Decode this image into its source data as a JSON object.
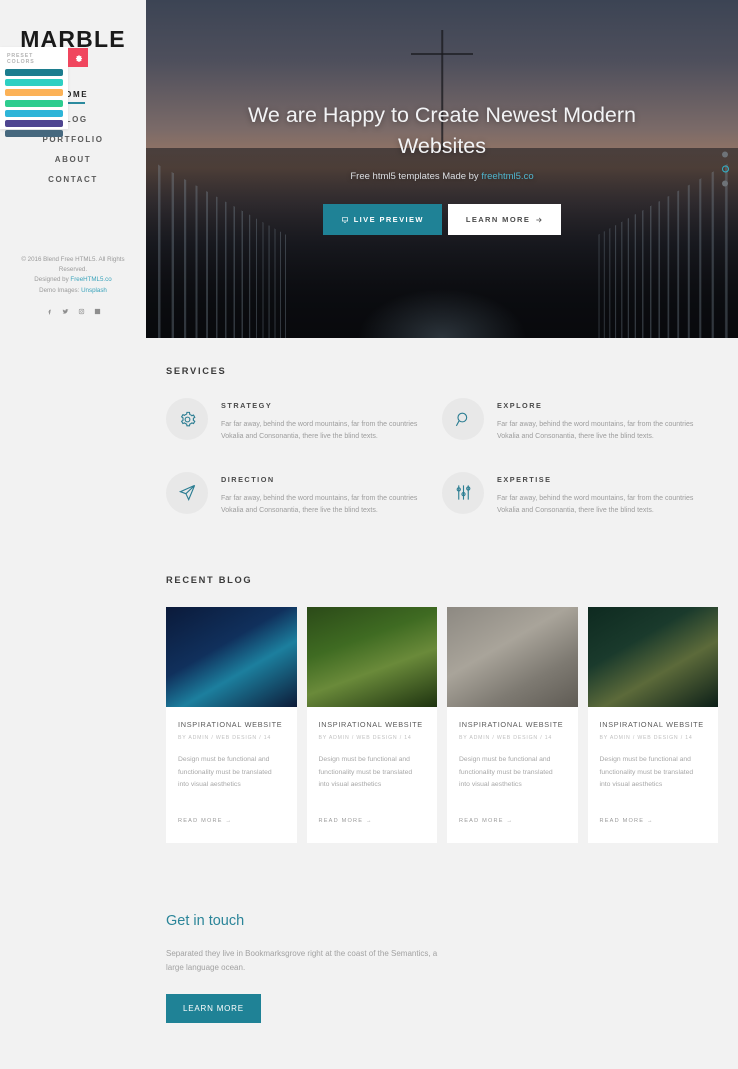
{
  "sidebar": {
    "logo": "MARBLE",
    "nav_items": [
      {
        "label": "HOME",
        "active": true
      },
      {
        "label": "BLOG",
        "active": false
      },
      {
        "label": "PORTFOLIO",
        "active": false
      },
      {
        "label": "ABOUT",
        "active": false
      },
      {
        "label": "CONTACT",
        "active": false
      }
    ],
    "preset_panel": {
      "title": "PRESET COLORS",
      "gear_icon": "gear-icon",
      "gear_bg": "#f0465e",
      "swatches": [
        "#1c7d8e",
        "#2ed0c3",
        "#fcb257",
        "#2ecc8f",
        "#2eb5d8",
        "#4e4590",
        "#46687e"
      ]
    },
    "footer": {
      "copyright": "© 2016 Blend Free HTML5. All Rights Reserved.",
      "designed_prefix": "Designed by ",
      "designed_link": "FreeHTML5.co",
      "demo_prefix": "Demo Images: ",
      "demo_link": "Unsplash",
      "socials": [
        "facebook-icon",
        "twitter-icon",
        "instagram-icon",
        "linkedin-icon"
      ]
    }
  },
  "hero": {
    "title": "We are Happy to Create Newest Modern Websites",
    "subtitle_prefix": "Free html5 templates Made by ",
    "subtitle_link": "freehtml5.co",
    "primary_button": "LIVE PREVIEW",
    "primary_icon": "monitor-icon",
    "primary_color": "#1f8296",
    "secondary_button": "LEARN MORE",
    "secondary_icon": "arrow-right-icon",
    "slider_dots": 3,
    "slider_active_index": 1,
    "slider_active_color": "#2fb5cd"
  },
  "services": {
    "heading": "SERVICES",
    "items": [
      {
        "icon": "gear-icon",
        "title": "STRATEGY",
        "text": "Far far away, behind the word mountains, far from the countries Vokalia and Consonantia, there live the blind texts."
      },
      {
        "icon": "search-icon",
        "title": "EXPLORE",
        "text": "Far far away, behind the word mountains, far from the countries Vokalia and Consonantia, there live the blind texts."
      },
      {
        "icon": "paper-plane-icon",
        "title": "DIRECTION",
        "text": "Far far away, behind the word mountains, far from the countries Vokalia and Consonantia, there live the blind texts."
      },
      {
        "icon": "sliders-icon",
        "title": "EXPERTISE",
        "text": "Far far away, behind the word mountains, far from the countries Vokalia and Consonantia, there live the blind texts."
      }
    ]
  },
  "blog": {
    "heading": "RECENT BLOG",
    "posts": [
      {
        "image": "jellyfish-photo",
        "title": "INSPIRATIONAL WEBSITE",
        "meta": "BY ADMIN / WEB DESIGN / 14",
        "text": "Design must be functional and functionality must be translated into visual aesthetics",
        "read_more": "READ MORE →"
      },
      {
        "image": "easter-eggs-nest-photo",
        "title": "INSPIRATIONAL WEBSITE",
        "meta": "BY ADMIN / WEB DESIGN / 14",
        "text": "Design must be functional and functionality must be translated into visual aesthetics",
        "read_more": "READ MORE →"
      },
      {
        "image": "christmas-ornaments-photo",
        "title": "INSPIRATIONAL WEBSITE",
        "meta": "BY ADMIN / WEB DESIGN / 14",
        "text": "Design must be functional and functionality must be translated into visual aesthetics",
        "read_more": "READ MORE →"
      },
      {
        "image": "thread-spools-photo",
        "title": "INSPIRATIONAL WEBSITE",
        "meta": "BY ADMIN / WEB DESIGN / 14",
        "text": "Design must be functional and functionality must be translated into visual aesthetics",
        "read_more": "READ MORE →"
      }
    ]
  },
  "cta": {
    "heading": "Get in touch",
    "heading_color": "#2b8599",
    "text": "Separated they live in Bookmarksgrove right at the coast of the Semantics, a large language ocean.",
    "button": "LEARN MORE",
    "button_color": "#1f8296"
  }
}
